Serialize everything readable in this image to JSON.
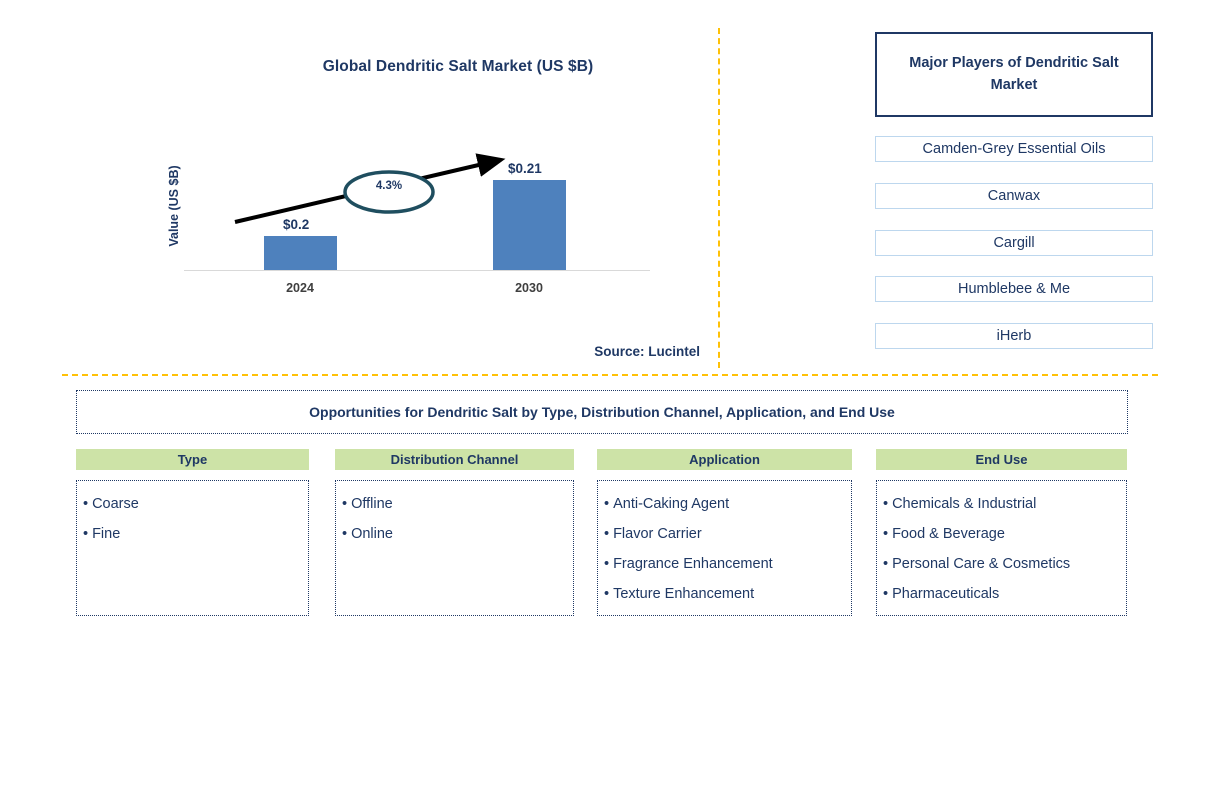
{
  "chart": {
    "title": "Global Dendritic Salt Market (US $B)",
    "y_axis_label": "Value (US $B)",
    "cagr_label": "4.3%",
    "source": "Source: Lucintel"
  },
  "chart_data": {
    "type": "bar",
    "title": "Global Dendritic Salt Market (US $B)",
    "categories": [
      "2024",
      "2030"
    ],
    "values": [
      0.2,
      0.21
    ],
    "data_labels": [
      "$0.2",
      "$0.21"
    ],
    "xlabel": "",
    "ylabel": "Value (US $B)",
    "ylim": [
      0,
      0.25
    ],
    "grid": false,
    "legend": "none",
    "annotations": [
      {
        "text": "4.3%",
        "type": "cagr-arrow",
        "from": "2024",
        "to": "2030"
      }
    ],
    "series_color": "#4E81BD",
    "source": "Source: Lucintel"
  },
  "players": {
    "header": "Major Players of Dendritic Salt Market",
    "items": [
      "Camden-Grey Essential Oils",
      "Canwax",
      "Cargill",
      "Humblebee & Me",
      "iHerb"
    ]
  },
  "opportunities": {
    "banner": "Opportunities for Dendritic Salt by Type, Distribution Channel, Application, and End Use",
    "bullet": "•",
    "columns": [
      {
        "header": "Type",
        "items": [
          "Coarse",
          "Fine"
        ]
      },
      {
        "header": "Distribution Channel",
        "items": [
          "Offline",
          "Online"
        ]
      },
      {
        "header": "Application",
        "items": [
          "Anti-Caking Agent",
          "Flavor Carrier",
          "Fragrance Enhancement",
          "Texture Enhancement"
        ]
      },
      {
        "header": "End Use",
        "items": [
          "Chemicals & Industrial",
          "Food & Beverage",
          "Personal Care & Cosmetics",
          "Pharmaceuticals"
        ]
      }
    ]
  },
  "colors": {
    "navy": "#1F3864",
    "bar_blue": "#4E81BD",
    "header_green": "#CDE3A7",
    "divider_gold": "#FFC107",
    "player_border": "#BDD7EE"
  }
}
